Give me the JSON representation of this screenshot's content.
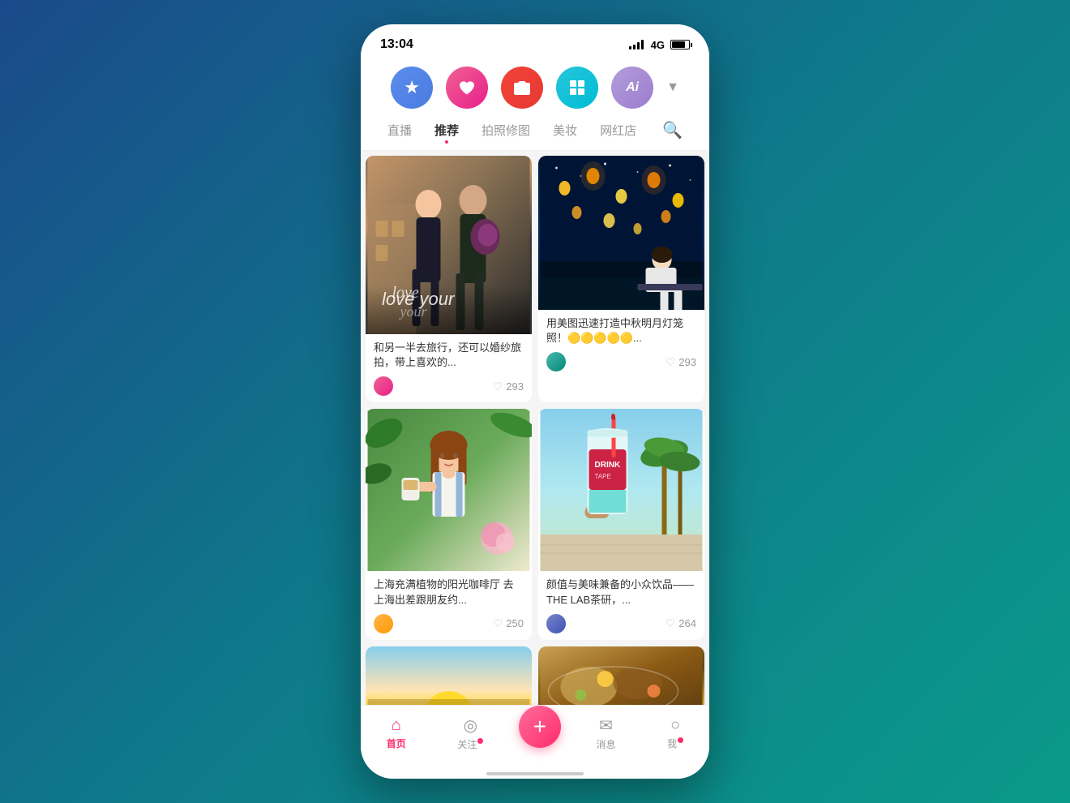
{
  "statusBar": {
    "time": "13:04",
    "network": "4G"
  },
  "topIcons": [
    {
      "id": "star",
      "label": "收藏",
      "colorClass": "icon-btn-star",
      "symbol": "★"
    },
    {
      "id": "heart",
      "label": "关注",
      "colorClass": "icon-btn-heart",
      "symbol": "♥"
    },
    {
      "id": "camera",
      "label": "拍照修图",
      "colorClass": "icon-btn-camera",
      "symbol": "📷"
    },
    {
      "id": "grid",
      "label": "网格",
      "colorClass": "icon-btn-grid",
      "symbol": "⊞"
    },
    {
      "id": "ai",
      "label": "AI",
      "colorClass": "icon-btn-ai",
      "symbol": "Ai"
    }
  ],
  "navTabs": [
    {
      "id": "live",
      "label": "直播",
      "active": false
    },
    {
      "id": "recommend",
      "label": "推荐",
      "active": true
    },
    {
      "id": "photo",
      "label": "拍照修图",
      "active": false
    },
    {
      "id": "makeup",
      "label": "美妆",
      "active": false
    },
    {
      "id": "shop",
      "label": "网红店",
      "active": false
    }
  ],
  "cards": [
    {
      "id": "card1",
      "title": "和另一半去旅行，还可以婚纱旅拍，带上喜欢的...",
      "likes": "293",
      "imageType": "couple"
    },
    {
      "id": "card2",
      "title": "用美图迅速打造中秋明月灯笼照！🟡🟡🟡🟡🟡...",
      "likes": "293",
      "imageType": "lanterns"
    },
    {
      "id": "card3",
      "title": "上海充满植物的阳光咖啡厅 去上海出差跟朋友约...",
      "likes": "250",
      "imageType": "coffee"
    },
    {
      "id": "card4",
      "title": "颜值与美味兼备的小众饮品——THE LAB茶研，...",
      "likes": "264",
      "imageType": "drink"
    }
  ],
  "bottomNav": [
    {
      "id": "home",
      "label": "首页",
      "icon": "⌂",
      "active": true,
      "badge": false
    },
    {
      "id": "follow",
      "label": "关注",
      "icon": "◎",
      "active": false,
      "badge": true
    },
    {
      "id": "plus",
      "label": "",
      "icon": "+",
      "active": false,
      "badge": false
    },
    {
      "id": "message",
      "label": "消息",
      "icon": "✉",
      "active": false,
      "badge": false
    },
    {
      "id": "me",
      "label": "我",
      "icon": "○",
      "active": false,
      "badge": true
    }
  ],
  "plusButton": {
    "label": "+"
  }
}
